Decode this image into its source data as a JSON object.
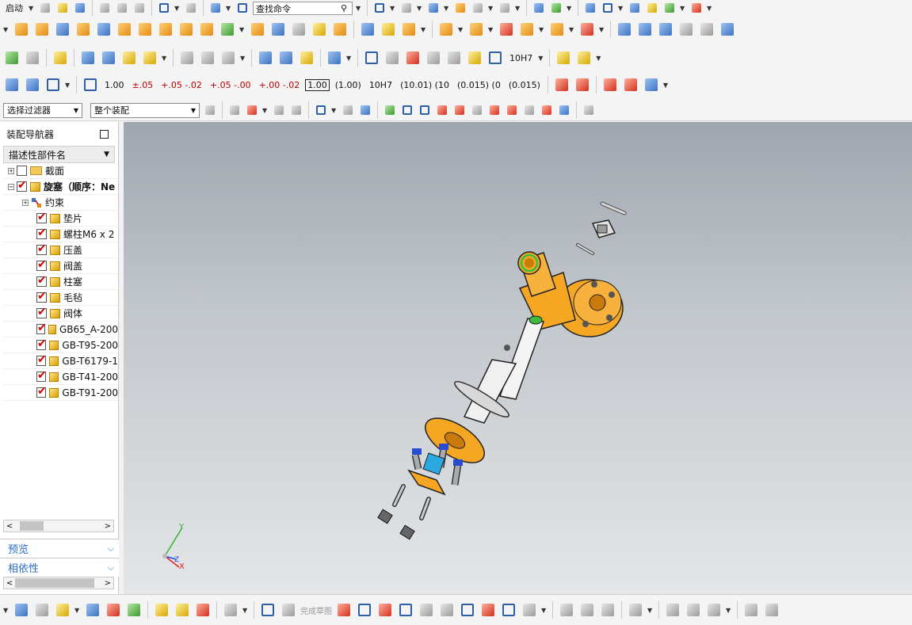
{
  "toolbar": {
    "start_label": "启动",
    "search_placeholder": "查找命令",
    "dims": [
      "1.00",
      "1.00",
      "1.00",
      "1.00",
      "1.00",
      "1.00",
      "(1.00)",
      "10H7",
      "10H7",
      "10H7",
      "10"
    ],
    "dims_sub": [
      "±.05",
      "+.05 -.02",
      "+.05 -.00",
      "+.00 -.02",
      "(10.01) (10",
      "(0.015) (0",
      "(0.015)"
    ],
    "fit_label": "10H7",
    "filter_select": "选择过滤器",
    "scope_select": "整个装配",
    "sketch_finish": "完成草图"
  },
  "navigator": {
    "title": "装配导航器",
    "column_header": "描述性部件名",
    "items": [
      {
        "label": "截面",
        "checked": false,
        "kind": "folder",
        "level": 0
      },
      {
        "label": "旋塞（顺序：Ne",
        "checked": true,
        "kind": "assembly",
        "level": 0
      },
      {
        "label": "约束",
        "checked": false,
        "kind": "constraint",
        "level": 1
      },
      {
        "label": "垫片",
        "checked": true,
        "kind": "part",
        "level": 1
      },
      {
        "label": "螺柱M6 x 2",
        "checked": true,
        "kind": "part",
        "level": 1
      },
      {
        "label": "压盖",
        "checked": true,
        "kind": "part",
        "level": 1
      },
      {
        "label": "阀盖",
        "checked": true,
        "kind": "part",
        "level": 1
      },
      {
        "label": "柱塞",
        "checked": true,
        "kind": "part",
        "level": 1
      },
      {
        "label": "毛毡",
        "checked": true,
        "kind": "part",
        "level": 1
      },
      {
        "label": "阀体",
        "checked": true,
        "kind": "part",
        "level": 1
      },
      {
        "label": "GB65_A-200",
        "checked": true,
        "kind": "part",
        "level": 1
      },
      {
        "label": "GB-T95-200",
        "checked": true,
        "kind": "part",
        "level": 1
      },
      {
        "label": "GB-T6179-1",
        "checked": true,
        "kind": "part",
        "level": 1
      },
      {
        "label": "GB-T41-200",
        "checked": true,
        "kind": "part",
        "level": 1
      },
      {
        "label": "GB-T91-200",
        "checked": true,
        "kind": "part",
        "level": 1
      }
    ],
    "panels": [
      {
        "label": "预览"
      },
      {
        "label": "相依性"
      }
    ]
  },
  "viewport": {
    "triad": {
      "x_label": "X",
      "y_label": "Y",
      "z_label": "Z"
    },
    "colors": {
      "part": "#f5a623",
      "part_dark": "#c97a0a",
      "shaft": "#eeeeee",
      "accent": "#2aa8e0"
    }
  }
}
